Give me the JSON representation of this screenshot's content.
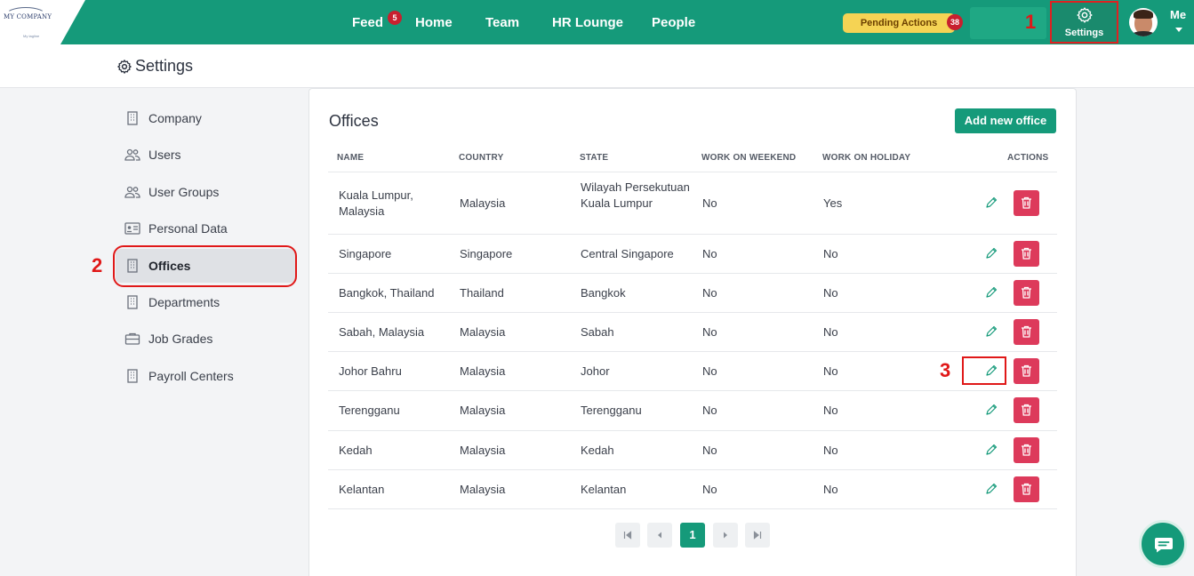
{
  "brand": {
    "logo_text": "MY COMPANY",
    "logo_sub": "My tagline"
  },
  "nav": {
    "items": [
      "Feed",
      "Home",
      "Team",
      "HR Lounge",
      "People"
    ],
    "feed_badge": "5",
    "pending_label": "Pending Actions",
    "pending_count": "38",
    "settings_label": "Settings",
    "me_label": "Me"
  },
  "annotations": [
    "1",
    "2",
    "3"
  ],
  "header": {
    "title": "Settings"
  },
  "sidebar": {
    "items": [
      {
        "label": "Company",
        "icon": "building-icon"
      },
      {
        "label": "Users",
        "icon": "users-icon"
      },
      {
        "label": "User Groups",
        "icon": "users-icon"
      },
      {
        "label": "Personal Data",
        "icon": "id-card-icon"
      },
      {
        "label": "Offices",
        "icon": "building-icon",
        "active": true
      },
      {
        "label": "Departments",
        "icon": "building-icon"
      },
      {
        "label": "Job Grades",
        "icon": "briefcase-icon"
      },
      {
        "label": "Payroll Centers",
        "icon": "building-icon"
      }
    ]
  },
  "offices": {
    "title": "Offices",
    "add_label": "Add new office",
    "columns": [
      "NAME",
      "COUNTRY",
      "STATE",
      "WORK ON WEEKEND",
      "WORK ON HOLIDAY",
      "ACTIONS"
    ],
    "rows": [
      {
        "name": "Kuala Lumpur, Malaysia",
        "country": "Malaysia",
        "state": "Wilayah Persekutuan Kuala Lumpur",
        "weekend": "No",
        "holiday": "Yes"
      },
      {
        "name": "Singapore",
        "country": "Singapore",
        "state": "Central Singapore",
        "weekend": "No",
        "holiday": "No"
      },
      {
        "name": "Bangkok, Thailand",
        "country": "Thailand",
        "state": "Bangkok",
        "weekend": "No",
        "holiday": "No"
      },
      {
        "name": "Sabah, Malaysia",
        "country": "Malaysia",
        "state": "Sabah",
        "weekend": "No",
        "holiday": "No"
      },
      {
        "name": "Johor Bahru",
        "country": "Malaysia",
        "state": "Johor",
        "weekend": "No",
        "holiday": "No"
      },
      {
        "name": "Terengganu",
        "country": "Malaysia",
        "state": "Terengganu",
        "weekend": "No",
        "holiday": "No"
      },
      {
        "name": "Kedah",
        "country": "Malaysia",
        "state": "Kedah",
        "weekend": "No",
        "holiday": "No"
      },
      {
        "name": "Kelantan",
        "country": "Malaysia",
        "state": "Kelantan",
        "weekend": "No",
        "holiday": "No"
      }
    ],
    "current_page": "1"
  },
  "colors": {
    "brand": "#159a7a",
    "danger": "#dd3a5b",
    "badge": "#c8202f",
    "pending": "#f5d354",
    "annotation": "#e01818"
  }
}
